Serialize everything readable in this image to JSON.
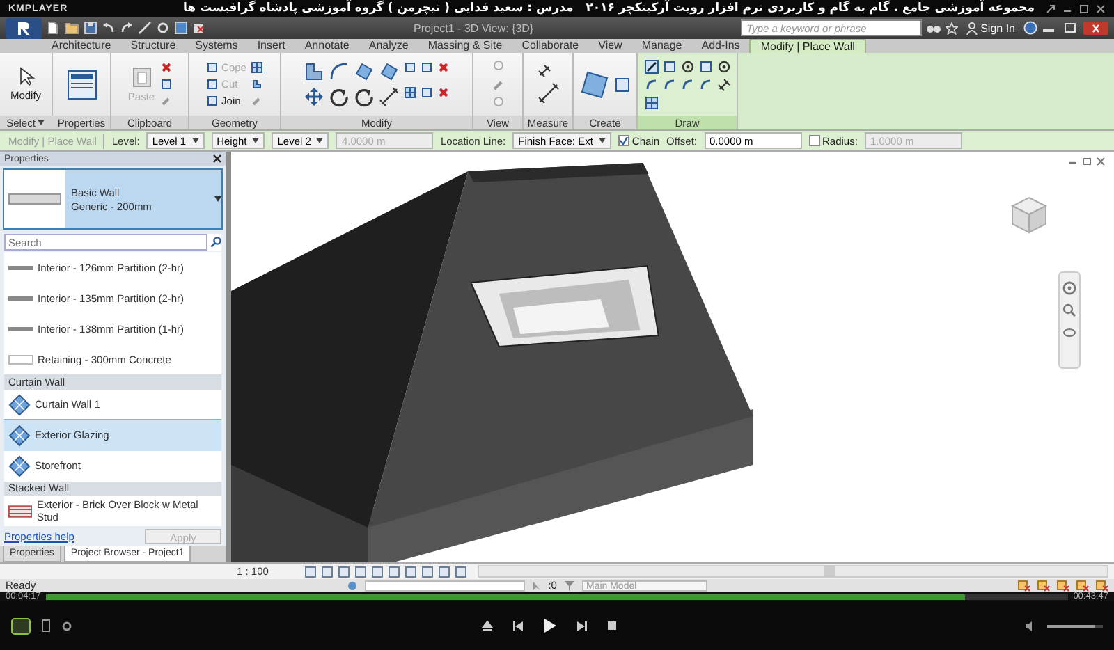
{
  "player": {
    "brand": "KMPLAYER",
    "title": "مجموعه آموزشی جامع . گام به گام و کاربردی نرم افزار رویت آرکیتکچر ۲۰۱۶   مدرس : سعید فدایی ( تیچرمن ) گروه آموزشی پادشاه گرافیست ها",
    "elapsed": "00:04:17",
    "total": "00:43:47",
    "progress": {
      "level": 0.9
    },
    "volume": {
      "level": 0.85
    }
  },
  "app": {
    "title": "Project1 - 3D View: {3D}",
    "search": {
      "placeholder": "Type a keyword or phrase"
    },
    "sign_in": "Sign In"
  },
  "ribbon_tabs": [
    {
      "label": "Architecture",
      "selected": false
    },
    {
      "label": "Structure",
      "selected": false
    },
    {
      "label": "Systems",
      "selected": false
    },
    {
      "label": "Insert",
      "selected": false
    },
    {
      "label": "Annotate",
      "selected": false
    },
    {
      "label": "Analyze",
      "selected": false
    },
    {
      "label": "Massing & Site",
      "selected": false
    },
    {
      "label": "Collaborate",
      "selected": false
    },
    {
      "label": "View",
      "selected": false
    },
    {
      "label": "Manage",
      "selected": false
    },
    {
      "label": "Add-Ins",
      "selected": false
    },
    {
      "label": "Modify | Place Wall",
      "selected": true
    }
  ],
  "ribbon_panels": [
    {
      "label": "Select",
      "menu": true,
      "contextual": false,
      "tools": [
        {
          "label": "Modify",
          "disabled": false
        }
      ]
    },
    {
      "label": "Properties",
      "menu": false,
      "contextual": false
    },
    {
      "label": "Clipboard",
      "menu": false,
      "contextual": false,
      "tools": [
        {
          "label": "Paste",
          "disabled": true
        }
      ]
    },
    {
      "label": "Geometry",
      "menu": false,
      "contextual": false,
      "tools": [
        {
          "label": "Cope",
          "disabled": true
        },
        {
          "label": "Cut",
          "disabled": true
        },
        {
          "label": "Join",
          "disabled": false
        }
      ]
    },
    {
      "label": "Modify",
      "menu": false,
      "contextual": false
    },
    {
      "label": "View",
      "menu": false,
      "contextual": false
    },
    {
      "label": "Measure",
      "menu": false,
      "contextual": false
    },
    {
      "label": "Create",
      "menu": false,
      "contextual": false
    },
    {
      "label": "Draw",
      "menu": false,
      "contextual": true
    }
  ],
  "options_bar": [
    {
      "kind": "label",
      "text": "Modify | Place Wall",
      "disabled": true
    },
    {
      "kind": "label",
      "text": "Level:",
      "disabled": false
    },
    {
      "kind": "dropdown",
      "value": "Level 1"
    },
    {
      "kind": "dropdown",
      "value": "Height"
    },
    {
      "kind": "dropdown",
      "value": "Level 2"
    },
    {
      "kind": "field",
      "value": "4.0000 m",
      "disabled": true
    },
    {
      "kind": "label",
      "text": "Location Line:",
      "disabled": false
    },
    {
      "kind": "dropdown",
      "value": "Finish Face: Ext"
    },
    {
      "kind": "checkbox",
      "text": "Chain",
      "checked": true
    },
    {
      "kind": "label",
      "text": "Offset:",
      "disabled": false
    },
    {
      "kind": "field",
      "value": "0.0000 m",
      "disabled": false
    },
    {
      "kind": "checkbox",
      "text": "Radius:",
      "checked": false
    },
    {
      "kind": "field",
      "value": "1.0000 m",
      "disabled": true
    }
  ],
  "properties": {
    "title": "Properties",
    "type_family": "Basic Wall",
    "type_name": "Generic - 200mm",
    "search": {
      "placeholder": "Search"
    },
    "items": [
      {
        "kind": "line",
        "label": "Interior - 126mm Partition (2-hr)",
        "selected": false
      },
      {
        "kind": "line",
        "label": "Interior - 135mm Partition (2-hr)",
        "selected": false
      },
      {
        "kind": "line",
        "label": "Interior - 138mm Partition (1-hr)",
        "selected": false
      },
      {
        "kind": "blank",
        "label": "Retaining - 300mm Concrete",
        "selected": false
      },
      {
        "kind": "group",
        "label": "Curtain Wall"
      },
      {
        "kind": "curtain",
        "label": "Curtain Wall 1",
        "selected": false
      },
      {
        "kind": "curtain",
        "label": "Exterior Glazing",
        "selected": true
      },
      {
        "kind": "curtain",
        "label": "Storefront",
        "selected": false
      },
      {
        "kind": "group",
        "label": "Stacked Wall"
      },
      {
        "kind": "stacked",
        "label": "Exterior - Brick Over Block w Metal Stud",
        "selected": false
      }
    ],
    "help_link": "Properties help",
    "apply": {
      "label": "Apply",
      "disabled": true
    },
    "tabs": [
      {
        "label": "Properties",
        "selected": false
      },
      {
        "label": "Project Browser - Project1",
        "selected": true
      }
    ]
  },
  "view_bar": {
    "scale": "1 : 100"
  },
  "status_bar": {
    "message": "Ready",
    "count": ":0",
    "model": "Main Model"
  }
}
